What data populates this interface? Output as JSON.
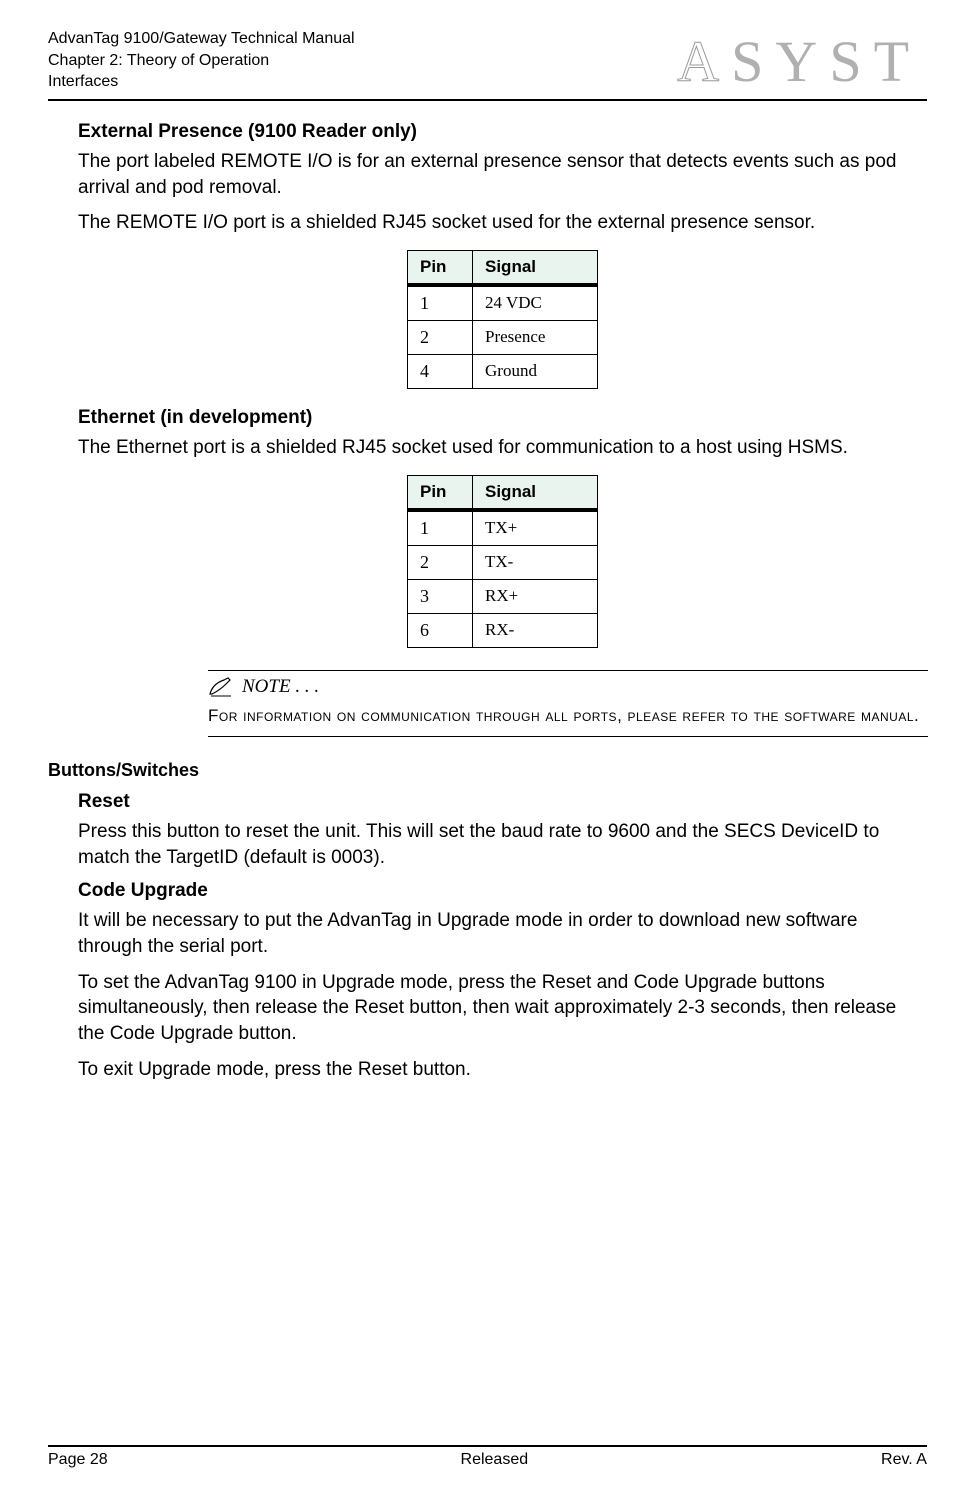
{
  "header": {
    "line1": "AdvanTag 9100/Gateway Technical Manual",
    "line2": "Chapter 2: Theory of Operation",
    "line3": "Interfaces",
    "logo_text": "SYST"
  },
  "sections": {
    "ext_presence": {
      "heading": "External Presence (9100 Reader only)",
      "para1": "The port labeled REMOTE I/O is for an external presence sensor that detects events such as pod arrival and pod removal.",
      "para2": "The REMOTE I/O port is a shielded RJ45 socket used for the external presence sensor.",
      "table_headers": {
        "pin": "Pin",
        "signal": "Signal"
      },
      "rows": [
        {
          "pin": "1",
          "signal": "24 VDC"
        },
        {
          "pin": "2",
          "signal": "Presence"
        },
        {
          "pin": "4",
          "signal": "Ground"
        }
      ]
    },
    "ethernet": {
      "heading": "Ethernet (in development)",
      "para1": "The Ethernet port is a shielded RJ45 socket used for communication to a host using HSMS.",
      "table_headers": {
        "pin": "Pin",
        "signal": "Signal"
      },
      "rows": [
        {
          "pin": "1",
          "signal": "TX+"
        },
        {
          "pin": "2",
          "signal": "TX-"
        },
        {
          "pin": "3",
          "signal": "RX+"
        },
        {
          "pin": "6",
          "signal": "RX-"
        }
      ]
    },
    "note": {
      "label": "NOTE . . .",
      "body": "For information on communication through all ports, please refer to the software manual."
    },
    "buttons": {
      "heading": "Buttons/Switches",
      "reset": {
        "heading": "Reset",
        "para": "Press this button to reset the unit. This will set the baud rate to 9600 and the SECS DeviceID to match the TargetID (default is 0003)."
      },
      "code_upgrade": {
        "heading": "Code Upgrade",
        "para1": "It will be necessary to put the AdvanTag in Upgrade mode in order to download new software through the serial port.",
        "para2": "To set the AdvanTag 9100 in Upgrade mode, press the Reset and Code Upgrade buttons simultaneously, then release the Reset button, then wait approximately 2-3 seconds, then release the Code Upgrade button.",
        "para3": "To exit Upgrade mode, press the Reset button."
      }
    }
  },
  "footer": {
    "left": "Page 28",
    "center": "Released",
    "right": "Rev. A"
  }
}
